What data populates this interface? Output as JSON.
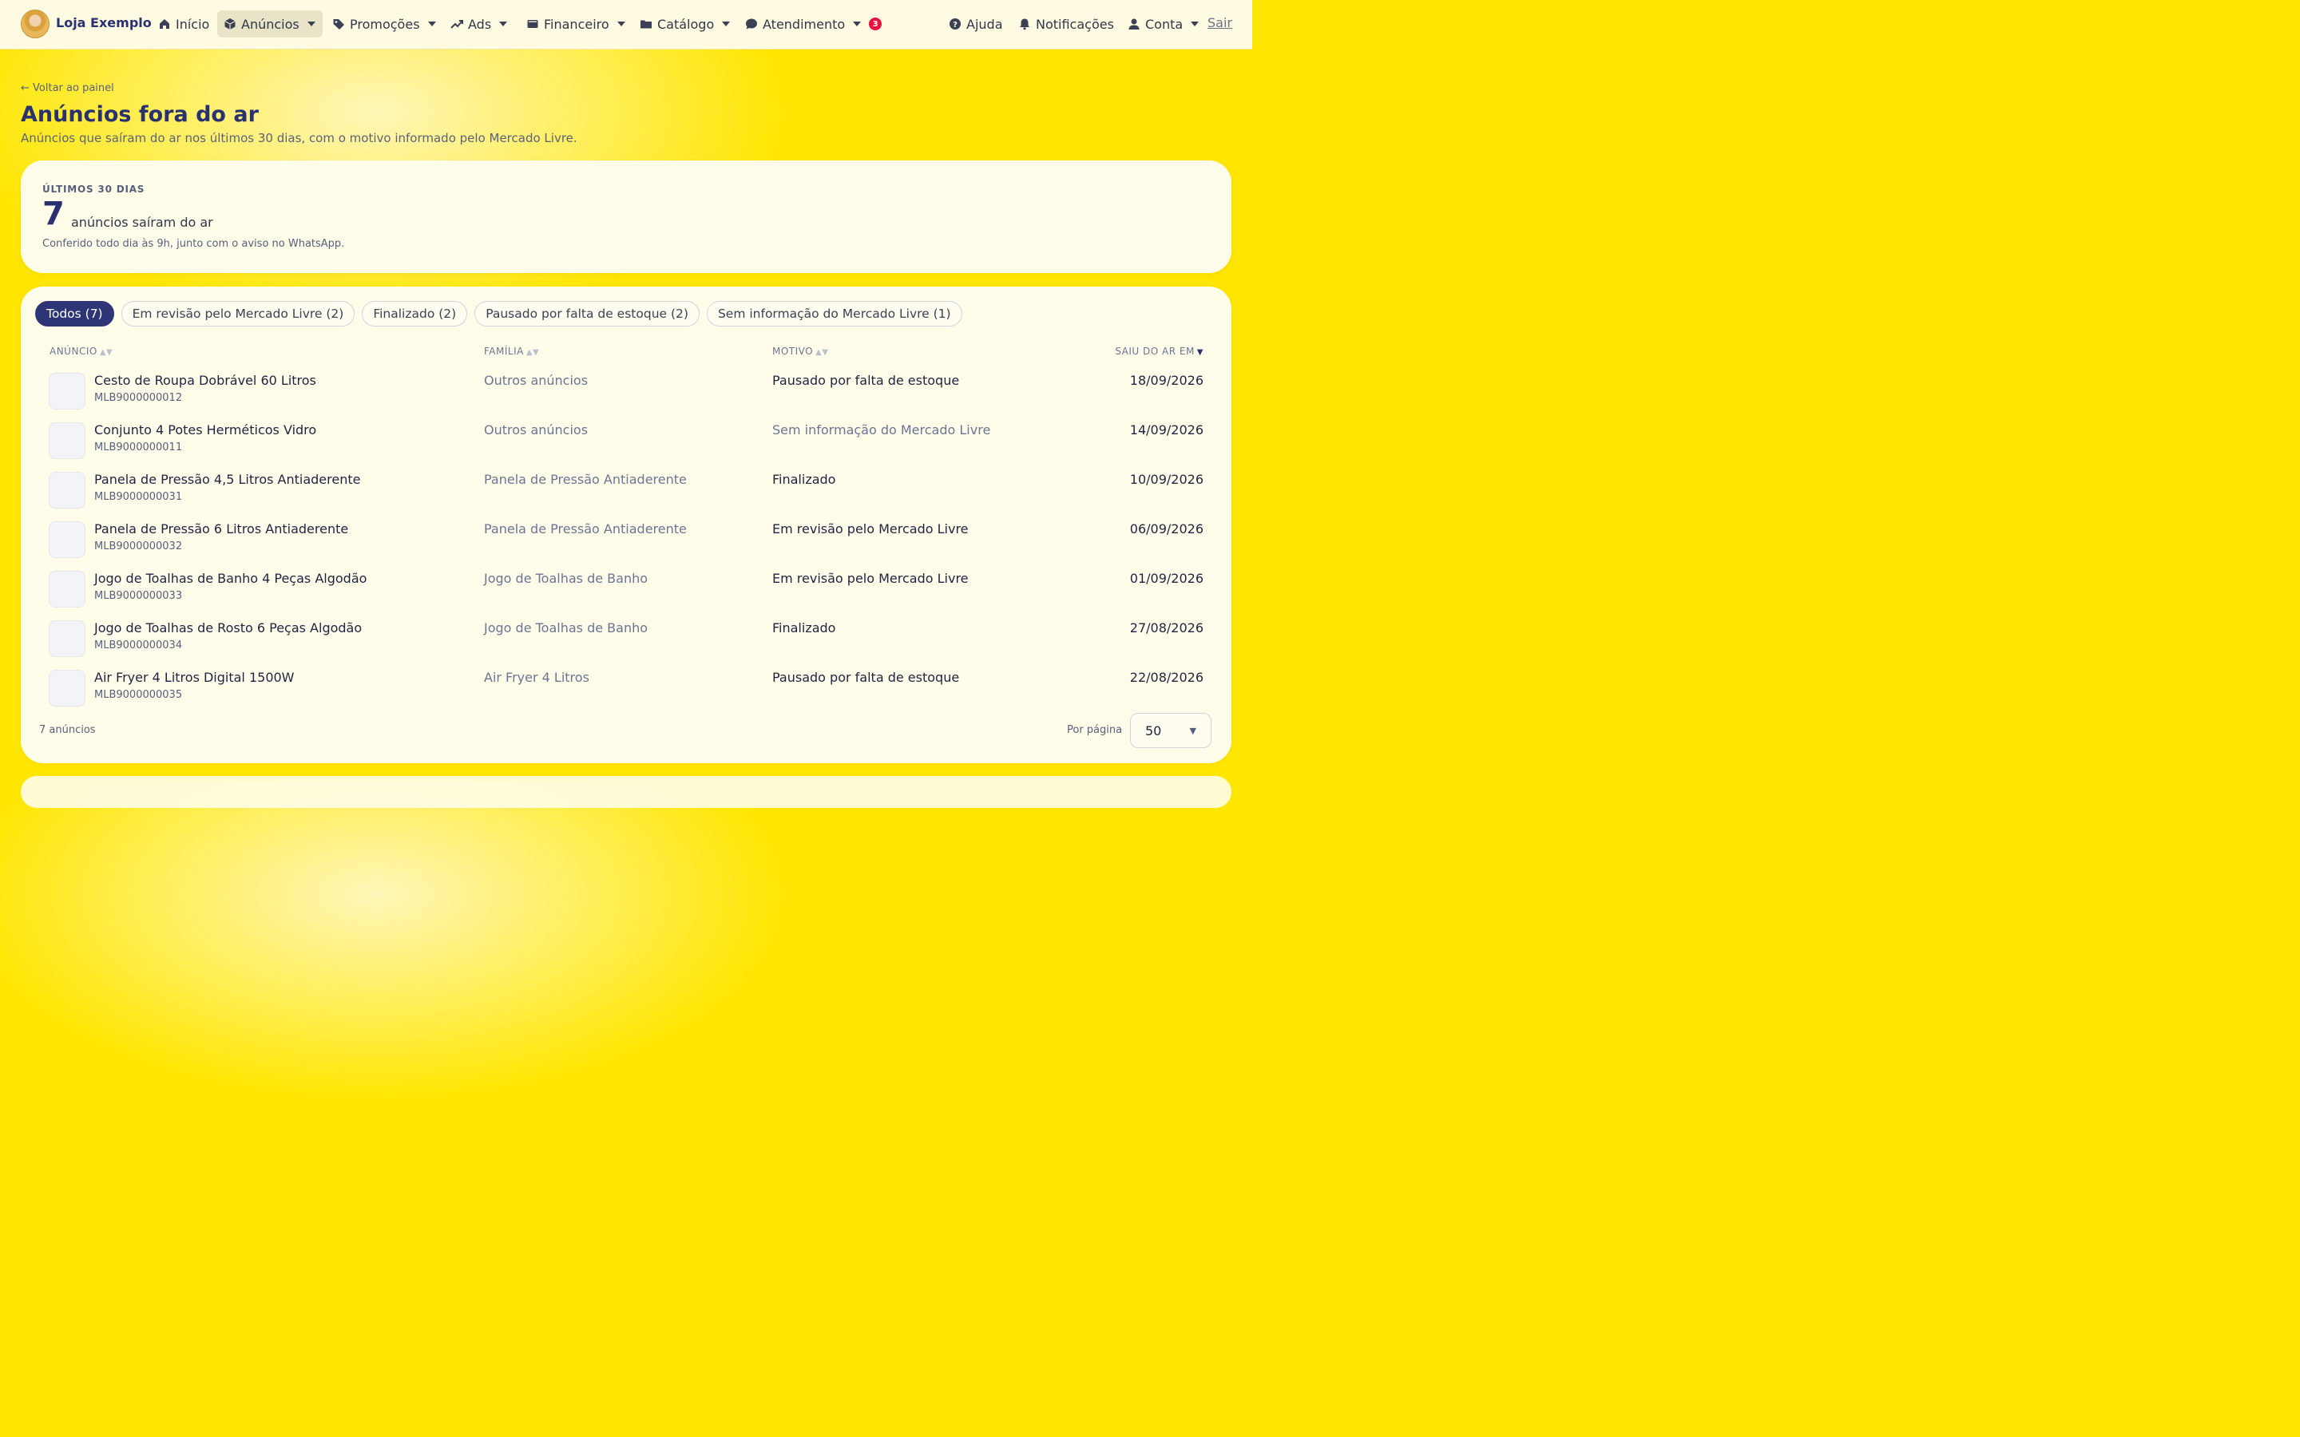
{
  "header": {
    "brand": "Loja Exemplo",
    "nav": [
      {
        "label": "Início",
        "icon": "home-icon"
      },
      {
        "label": "Anúncios",
        "icon": "box-icon",
        "active": true
      },
      {
        "label": "Promoções",
        "icon": "tag-icon"
      },
      {
        "label": "Ads",
        "icon": "trend-icon"
      },
      {
        "label": "Financeiro",
        "icon": "wallet-icon"
      },
      {
        "label": "Catálogo",
        "icon": "folder-icon"
      },
      {
        "label": "Atendimento",
        "icon": "chat-icon",
        "badge": "3"
      }
    ],
    "right": [
      {
        "label": "Ajuda",
        "icon": "help-icon"
      },
      {
        "label": "Notificações",
        "icon": "bell-icon"
      },
      {
        "label": "Conta",
        "icon": "user-icon"
      }
    ],
    "logout": "Sair"
  },
  "page": {
    "back": "← Voltar ao painel",
    "title": "Anúncios fora do ar",
    "subtitle": "Anúncios que saíram do ar nos últimos 30 dias, com o motivo informado pelo Mercado Livre."
  },
  "summary": {
    "kicker": "ÚLTIMOS 30 DIAS",
    "count": "7",
    "text": "anúncios saíram do ar",
    "note": "Conferido todo dia às 9h, junto com o aviso no WhatsApp."
  },
  "filters": [
    "Todos (7)",
    "Em revisão pelo Mercado Livre (2)",
    "Finalizado (2)",
    "Pausado por falta de estoque (2)",
    "Sem informação do Mercado Livre (1)"
  ],
  "table": {
    "columns": {
      "listing": "ANÚNCIO",
      "family": "FAMÍLIA",
      "reason": "MOTIVO",
      "date": "SAIU DO AR EM"
    },
    "rows": [
      {
        "title": "Cesto de Roupa Dobrável 60 Litros",
        "id": "MLB9000000012",
        "family": "Outros anúncios",
        "reason": "Pausado por falta de estoque",
        "date": "18/09/2026"
      },
      {
        "title": "Conjunto 4 Potes Herméticos Vidro",
        "id": "MLB9000000011",
        "family": "Outros anúncios",
        "reason": "Sem informação do Mercado Livre",
        "date": "14/09/2026"
      },
      {
        "title": "Panela de Pressão 4,5 Litros Antiaderente",
        "id": "MLB9000000031",
        "family": "Panela de Pressão Antiaderente",
        "reason": "Finalizado",
        "date": "10/09/2026"
      },
      {
        "title": "Panela de Pressão 6 Litros Antiaderente",
        "id": "MLB9000000032",
        "family": "Panela de Pressão Antiaderente",
        "reason": "Em revisão pelo Mercado Livre",
        "date": "06/09/2026"
      },
      {
        "title": "Jogo de Toalhas de Banho 4 Peças Algodão",
        "id": "MLB9000000033",
        "family": "Jogo de Toalhas de Banho",
        "reason": "Em revisão pelo Mercado Livre",
        "date": "01/09/2026"
      },
      {
        "title": "Jogo de Toalhas de Rosto 6 Peças Algodão",
        "id": "MLB9000000034",
        "family": "Jogo de Toalhas de Banho",
        "reason": "Finalizado",
        "date": "27/08/2026"
      },
      {
        "title": "Air Fryer 4 Litros Digital 1500W",
        "id": "MLB9000000035",
        "family": "Air Fryer 4 Litros",
        "reason": "Pausado por falta de estoque",
        "date": "22/08/2026"
      }
    ]
  },
  "footer": {
    "count": "7 anúncios",
    "per_page_label": "Por página",
    "per_page_value": "50"
  }
}
